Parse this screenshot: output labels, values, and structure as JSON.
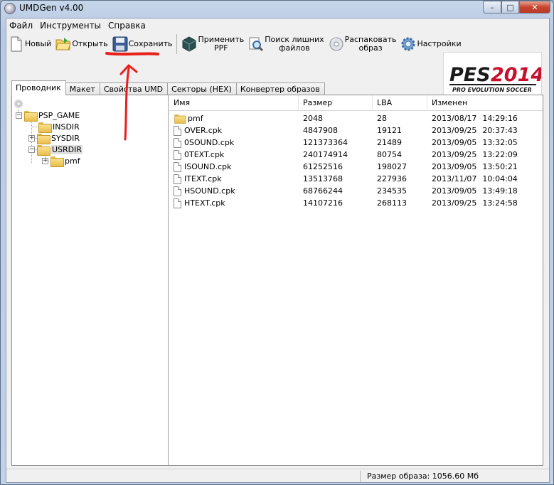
{
  "window": {
    "title": "UMDGen v4.00"
  },
  "menu": [
    "Файл",
    "Инструменты",
    "Справка"
  ],
  "toolbar": {
    "new": "Новый",
    "open": "Открыть",
    "save": "Сохранить",
    "apply_ppf_1": "Применить",
    "apply_ppf_2": "PPF",
    "find_extra_1": "Поиск лишних",
    "find_extra_2": "файлов",
    "unpack_1": "Распаковать",
    "unpack_2": "образ",
    "settings": "Настройки"
  },
  "logo": {
    "main": "PES2014",
    "sub": "PRO EVOLUTION SOCCER",
    "brand_color": "#c8102e"
  },
  "tabs": [
    "Проводник",
    "Макет",
    "Свойства UMD",
    "Секторы (HEX)",
    "Конвертер образов"
  ],
  "tree": {
    "root": "PSP_GAME",
    "children": [
      "INSDIR",
      "SYSDIR",
      "USRDIR"
    ],
    "usrdir_child": "pmf"
  },
  "list": {
    "headers": [
      "Имя",
      "Размер",
      "LBA",
      "Изменен"
    ],
    "rows": [
      {
        "type": "folder",
        "name": "pmf",
        "size": "2048",
        "lba": "28",
        "date": "2013/08/17",
        "time": "14:29:16"
      },
      {
        "type": "file",
        "name": "OVER.cpk",
        "size": "4847908",
        "lba": "19121",
        "date": "2013/09/25",
        "time": "20:37:43"
      },
      {
        "type": "file",
        "name": "0SOUND.cpk",
        "size": "121373364",
        "lba": "21489",
        "date": "2013/09/05",
        "time": "13:32:05"
      },
      {
        "type": "file",
        "name": "0TEXT.cpk",
        "size": "240174914",
        "lba": "80754",
        "date": "2013/09/25",
        "time": "13:22:09"
      },
      {
        "type": "file",
        "name": "ISOUND.cpk",
        "size": "61252516",
        "lba": "198027",
        "date": "2013/09/05",
        "time": "13:50:21"
      },
      {
        "type": "file",
        "name": "ITEXT.cpk",
        "size": "13513768",
        "lba": "227936",
        "date": "2013/11/07",
        "time": "10:04:04"
      },
      {
        "type": "file",
        "name": "HSOUND.cpk",
        "size": "68766244",
        "lba": "234535",
        "date": "2013/09/05",
        "time": "13:49:18"
      },
      {
        "type": "file",
        "name": "HTEXT.cpk",
        "size": "14107216",
        "lba": "268113",
        "date": "2013/09/25",
        "time": "13:24:58"
      }
    ]
  },
  "status": {
    "image_size": "Размер образа: 1056.60 Мб"
  },
  "annotation_color": "#e8201a"
}
